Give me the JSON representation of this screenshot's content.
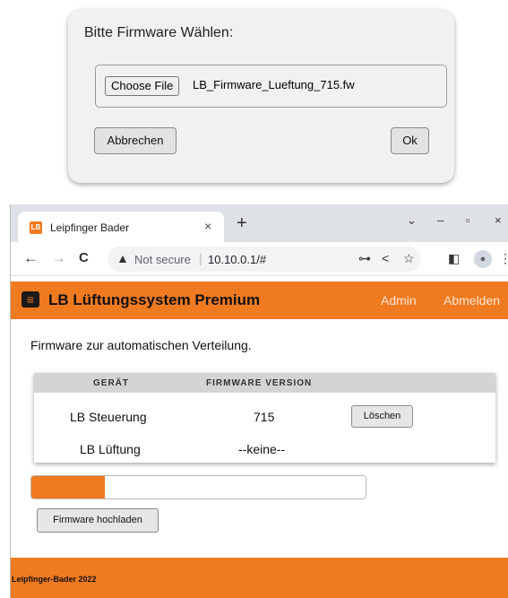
{
  "dialog": {
    "title": "Bitte Firmware Wählen:",
    "choose_file_label": "Choose File",
    "file_name": "LB_Firmware_Lueftung_715.fw",
    "cancel_label": "Abbrechen",
    "ok_label": "Ok"
  },
  "browser": {
    "tab_favicon": "LB",
    "tab_title": "Leipfinger Bader",
    "tab_close": "×",
    "new_tab": "+",
    "win_dropdown": "⌄",
    "win_minimize": "–",
    "win_maximize": "▫",
    "win_close": "×",
    "nav_back": "←",
    "nav_forward": "→",
    "nav_reload": "C",
    "security_icon": "▲",
    "security_text": "Not secure",
    "url_separator": "|",
    "url": "10.10.0.1/#",
    "key_icon": "⊶",
    "share_icon": "<",
    "star_icon": "☆",
    "sidepanel_icon": "◧",
    "profile_icon": "●",
    "more_icon": "⋮"
  },
  "app": {
    "menu_icon": "≡",
    "title": "LB Lüftungssystem Premium",
    "nav": [
      "Admin",
      "Abmelden"
    ],
    "intro": "Firmware zur automatischen Verteilung.",
    "table": {
      "headers": [
        "GERÄT",
        "FIRMWARE VERSION"
      ],
      "rows": [
        {
          "device": "LB Steuerung",
          "version": "715",
          "action": "Löschen"
        },
        {
          "device": "LB Lüftung",
          "version": "--keine--"
        }
      ]
    },
    "upload_progress": 0.22,
    "upload_label": "Firmware hochladen",
    "footer": "Leipfinger-Bader 2022"
  },
  "colors": {
    "accent": "#f07a20",
    "table_header": "#d4d4d4",
    "dialog_bg": "#f1f1f1"
  }
}
